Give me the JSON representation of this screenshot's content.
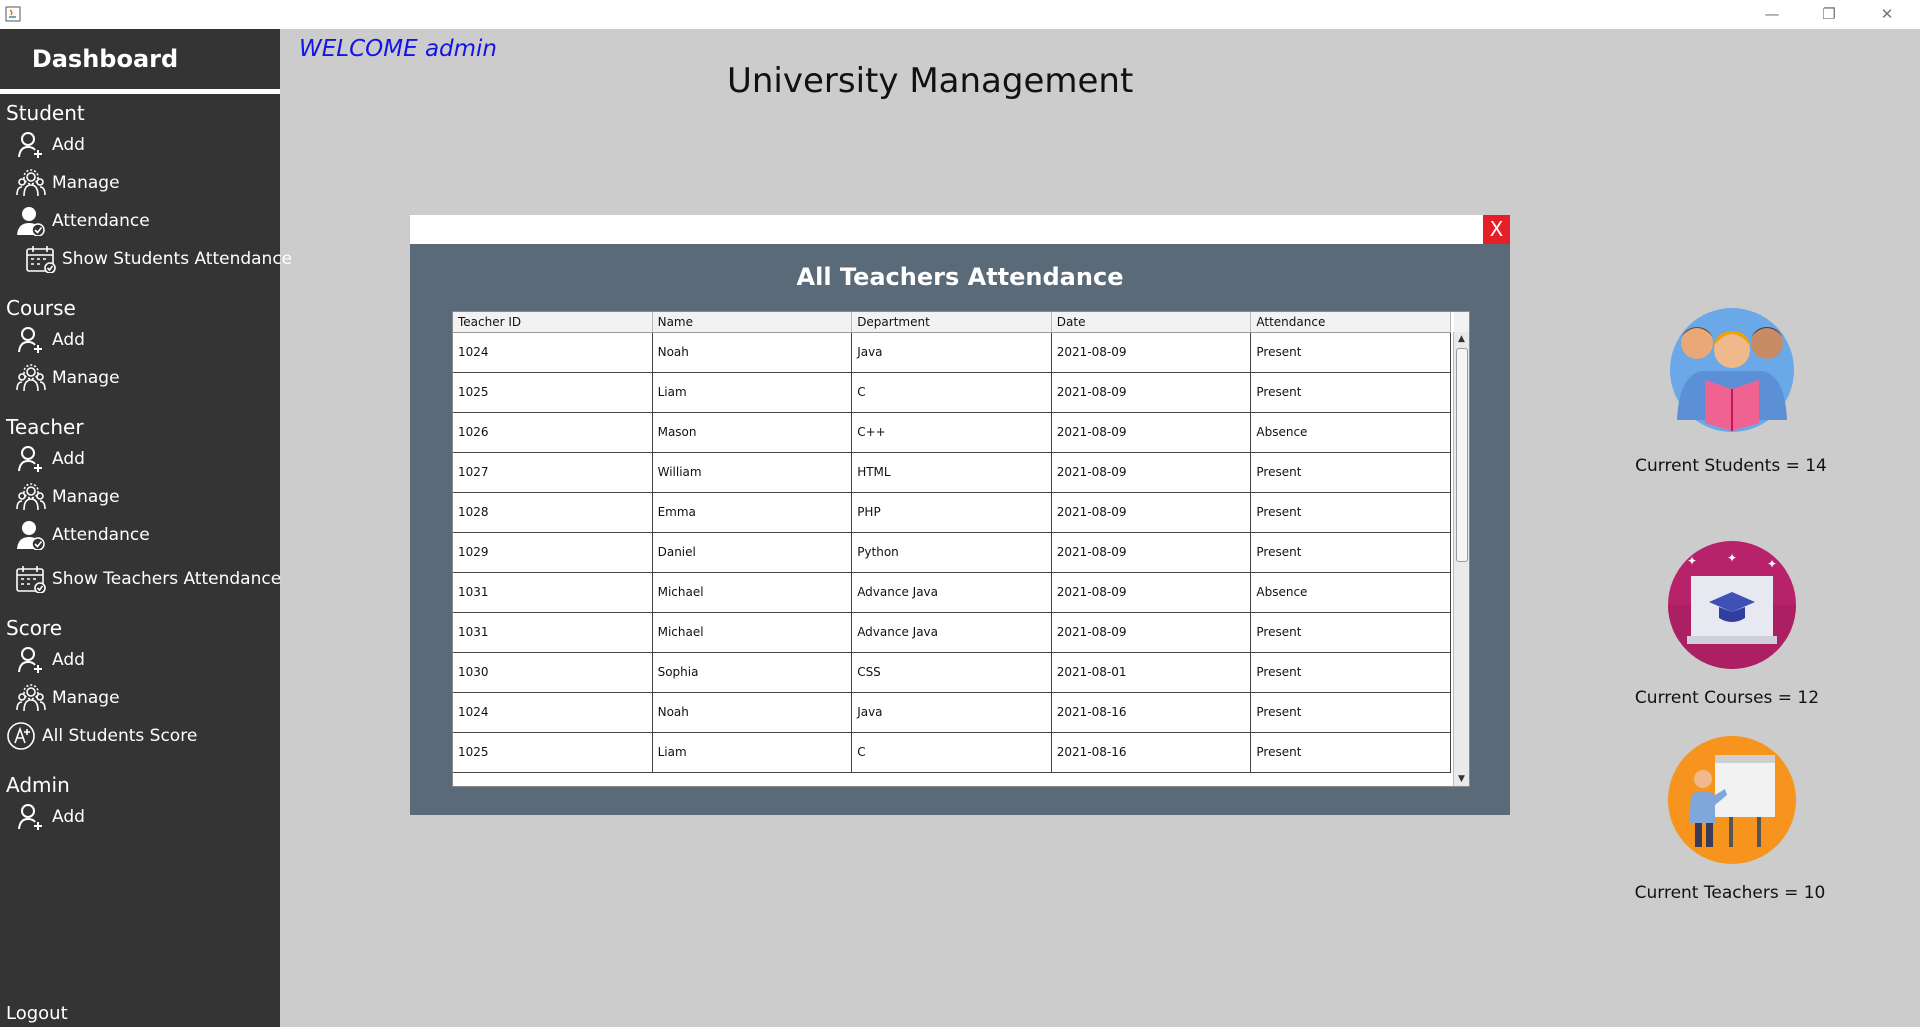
{
  "window": {
    "controls": {
      "minimize": "—",
      "restore": "❐",
      "close": "✕"
    }
  },
  "sidebar": {
    "title": "Dashboard",
    "sections": {
      "student": {
        "label": "Student",
        "add": "Add",
        "manage": "Manage",
        "attendance": "Attendance",
        "show_attendance": "Show Students Attendance"
      },
      "course": {
        "label": "Course",
        "add": "Add",
        "manage": "Manage"
      },
      "teacher": {
        "label": "Teacher",
        "add": "Add",
        "manage": "Manage",
        "attendance": "Attendance",
        "show_attendance": "Show Teachers Attendance"
      },
      "score": {
        "label": "Score",
        "add": "Add",
        "manage": "Manage",
        "all_scores": "All Students Score"
      },
      "admin": {
        "label": "Admin",
        "add": "Add"
      }
    },
    "logout": "Logout"
  },
  "header": {
    "welcome": "WELCOME admin",
    "title": "University Management"
  },
  "dialog": {
    "title": "All Teachers Attendance",
    "close_label": "X",
    "columns": [
      "Teacher ID",
      "Name",
      "Department",
      "Date",
      "Attendance"
    ],
    "rows": [
      [
        "1024",
        "Noah",
        "Java",
        "2021-08-09",
        "Present"
      ],
      [
        "1025",
        "Liam",
        "C",
        "2021-08-09",
        "Present"
      ],
      [
        "1026",
        "Mason",
        "C++",
        "2021-08-09",
        "Absence"
      ],
      [
        "1027",
        "William",
        "HTML",
        "2021-08-09",
        "Present"
      ],
      [
        "1028",
        "Emma",
        "PHP",
        "2021-08-09",
        "Present"
      ],
      [
        "1029",
        "Daniel",
        "Python",
        "2021-08-09",
        "Present"
      ],
      [
        "1031",
        "Michael",
        "Advance Java",
        "2021-08-09",
        "Absence"
      ],
      [
        "1031",
        "Michael",
        "Advance Java",
        "2021-08-09",
        "Present"
      ],
      [
        "1030",
        "Sophia",
        "CSS",
        "2021-08-01",
        "Present"
      ],
      [
        "1024",
        "Noah",
        "Java",
        "2021-08-16",
        "Present"
      ],
      [
        "1025",
        "Liam",
        "C",
        "2021-08-16",
        "Present"
      ]
    ]
  },
  "stats": {
    "students": "Current Students = 14",
    "courses": "Current Courses = 12",
    "teachers": "Current Teachers = 10"
  },
  "colors": {
    "sidebar_bg": "#343434",
    "page_bg": "#cccccc",
    "dialog_bg": "#5a6a79",
    "welcome_text": "#1414e6",
    "close_button": "#e61e28"
  }
}
